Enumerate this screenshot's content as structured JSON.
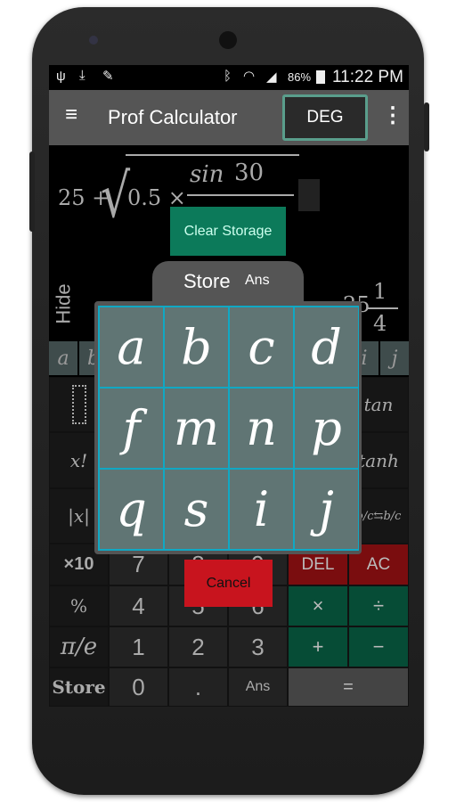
{
  "status": {
    "battery": "86%",
    "time": "11:22 PM"
  },
  "appbar": {
    "title": "Prof Calculator",
    "mode": "DEG"
  },
  "display": {
    "expr_a": "25 +",
    "expr_b": "0.5 ×",
    "func": "sin",
    "arg": "30",
    "result_whole": "25",
    "result_num": "1",
    "result_den": "4"
  },
  "hide_label": "Hide",
  "vars": [
    "a",
    "b",
    "i",
    "j"
  ],
  "left_keys": [
    "x!",
    "|x|",
    "×10",
    "%",
    "π/e",
    "Store"
  ],
  "right_keys": [
    "tan",
    "tanh",
    "b/c⇆b/c"
  ],
  "digits": [
    [
      "7",
      "8",
      "9"
    ],
    [
      "4",
      "5",
      "6"
    ],
    [
      "1",
      "2",
      "3"
    ],
    [
      "0",
      ".",
      "Ans"
    ]
  ],
  "ops": {
    "del": "DEL",
    "ac": "AC",
    "mul": "×",
    "div": "÷",
    "add": "+",
    "sub": "−",
    "eq": "="
  },
  "dialog": {
    "clear": "Clear Storage",
    "title": "Store",
    "subtitle": "Ans",
    "cells": [
      "a",
      "b",
      "c",
      "d",
      "f",
      "m",
      "n",
      "p",
      "q",
      "s",
      "i",
      "j"
    ],
    "cancel": "Cancel"
  },
  "colors": {
    "accent": "#10a8c4",
    "clear": "#0c7a5a",
    "cancel": "#c8141e",
    "deg_border": "#5a9e8c"
  }
}
